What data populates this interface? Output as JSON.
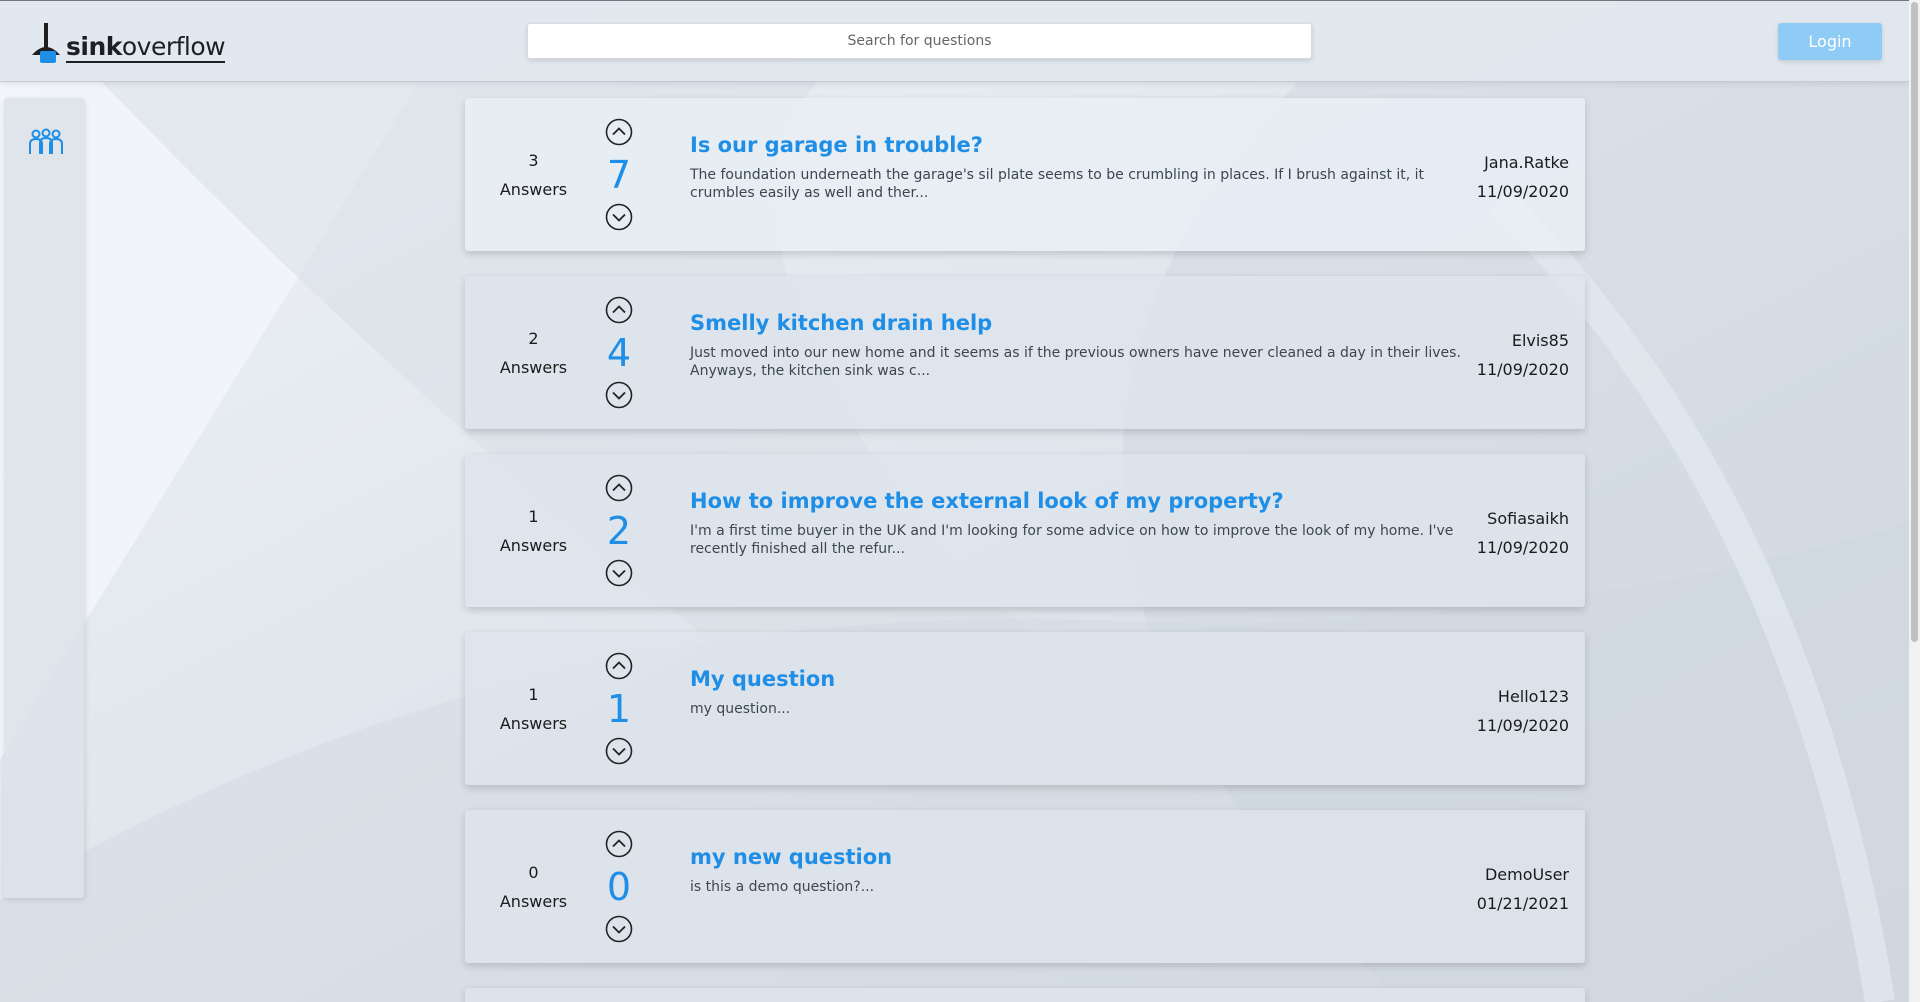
{
  "header": {
    "logo_text_bold": "sink",
    "logo_text_rest": "overflow",
    "search_placeholder": "Search for questions",
    "login_label": "Login"
  },
  "sidebar": {
    "items": [
      {
        "icon": "community-icon"
      }
    ]
  },
  "questions": [
    {
      "answers_count": "3",
      "answers_label": "Answers",
      "score": "7",
      "title": "Is our garage in trouble?",
      "excerpt": "The foundation underneath the garage's sil plate seems to be crumbling in places. If I brush against it, it crumbles easily as well and ther...",
      "author": "Jana.Ratke",
      "date": "11/09/2020"
    },
    {
      "answers_count": "2",
      "answers_label": "Answers",
      "score": "4",
      "title": "Smelly kitchen drain help",
      "excerpt": "Just moved into our new home and it seems as if the previous owners have never cleaned a day in their lives. Anyways, the kitchen sink was c...",
      "author": "Elvis85",
      "date": "11/09/2020"
    },
    {
      "answers_count": "1",
      "answers_label": "Answers",
      "score": "2",
      "title": "How to improve the external look of my property?",
      "excerpt": "I'm a first time buyer in the UK and I'm looking for some advice on how to improve the look of my home. I've recently finished all the refur...",
      "author": "Sofiasaikh",
      "date": "11/09/2020"
    },
    {
      "answers_count": "1",
      "answers_label": "Answers",
      "score": "1",
      "title": "My question",
      "excerpt": "my question...",
      "author": "Hello123",
      "date": "11/09/2020"
    },
    {
      "answers_count": "0",
      "answers_label": "Answers",
      "score": "0",
      "title": "my new question",
      "excerpt": "is this a demo question?...",
      "author": "DemoUser",
      "date": "01/21/2021"
    }
  ],
  "colors": {
    "accent": "#1e8ee6",
    "login_button": "#8fccf5",
    "header_bg": "#e1e7ee"
  },
  "icons": {
    "upvote": "chevron-up-circle-icon",
    "downvote": "chevron-down-circle-icon",
    "logo": "plunger-icon"
  }
}
